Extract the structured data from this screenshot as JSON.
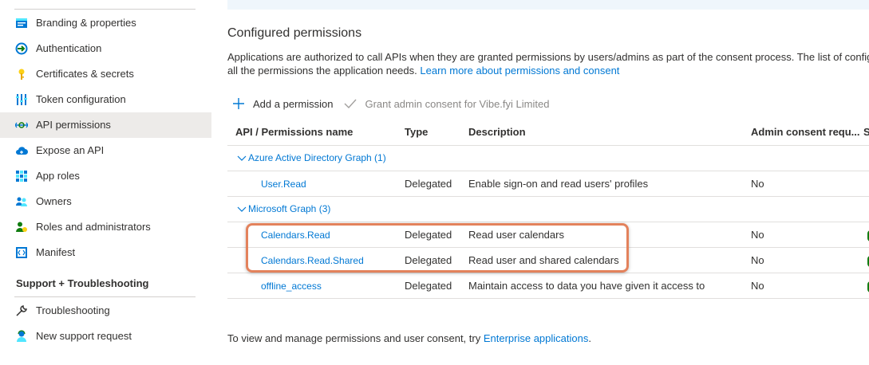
{
  "sidebar": {
    "items": [
      {
        "label": "Branding & properties",
        "icon": "branding-icon"
      },
      {
        "label": "Authentication",
        "icon": "authentication-icon"
      },
      {
        "label": "Certificates & secrets",
        "icon": "key-icon"
      },
      {
        "label": "Token configuration",
        "icon": "token-config-icon"
      },
      {
        "label": "API permissions",
        "icon": "api-permissions-icon",
        "active": true
      },
      {
        "label": "Expose an API",
        "icon": "cloud-icon"
      },
      {
        "label": "App roles",
        "icon": "app-roles-icon"
      },
      {
        "label": "Owners",
        "icon": "owners-icon"
      },
      {
        "label": "Roles and administrators",
        "icon": "roles-admin-icon"
      },
      {
        "label": "Manifest",
        "icon": "manifest-icon"
      }
    ],
    "support_section": "Support + Troubleshooting",
    "support_items": [
      {
        "label": "Troubleshooting",
        "icon": "wrench-icon"
      },
      {
        "label": "New support request",
        "icon": "support-person-icon"
      }
    ]
  },
  "main": {
    "title": "Configured permissions",
    "description_line1": "Applications are authorized to call APIs when they are granted permissions by users/admins as part of the consent process. The list of configu",
    "description_line2_text": "all the permissions the application needs. ",
    "description_link": "Learn more about permissions and consent",
    "toolbar": {
      "add_permission": "Add a permission",
      "grant_consent": "Grant admin consent for Vibe.fyi Limited"
    },
    "table": {
      "headers": {
        "api": "API / Permissions name",
        "type": "Type",
        "description": "Description",
        "admin": "Admin consent requ...",
        "status": "S"
      },
      "groups": [
        {
          "name": "Azure Active Directory Graph (1)",
          "rows": [
            {
              "name": "User.Read",
              "type": "Delegated",
              "description": "Enable sign-on and read users' profiles",
              "admin": "No"
            }
          ]
        },
        {
          "name": "Microsoft Graph (3)",
          "rows": [
            {
              "name": "Calendars.Read",
              "type": "Delegated",
              "description": "Read user calendars",
              "admin": "No"
            },
            {
              "name": "Calendars.Read.Shared",
              "type": "Delegated",
              "description": "Read user and shared calendars",
              "admin": "No"
            },
            {
              "name": "offline_access",
              "type": "Delegated",
              "description": "Maintain access to data you have given it access to",
              "admin": "No"
            }
          ]
        }
      ]
    },
    "footer_text": "To view and manage permissions and user consent, try ",
    "footer_link": "Enterprise applications",
    "footer_end": "."
  },
  "colors": {
    "accent": "#0078d4",
    "highlight": "#e3825c",
    "active_item_bg": "#edebe9"
  }
}
